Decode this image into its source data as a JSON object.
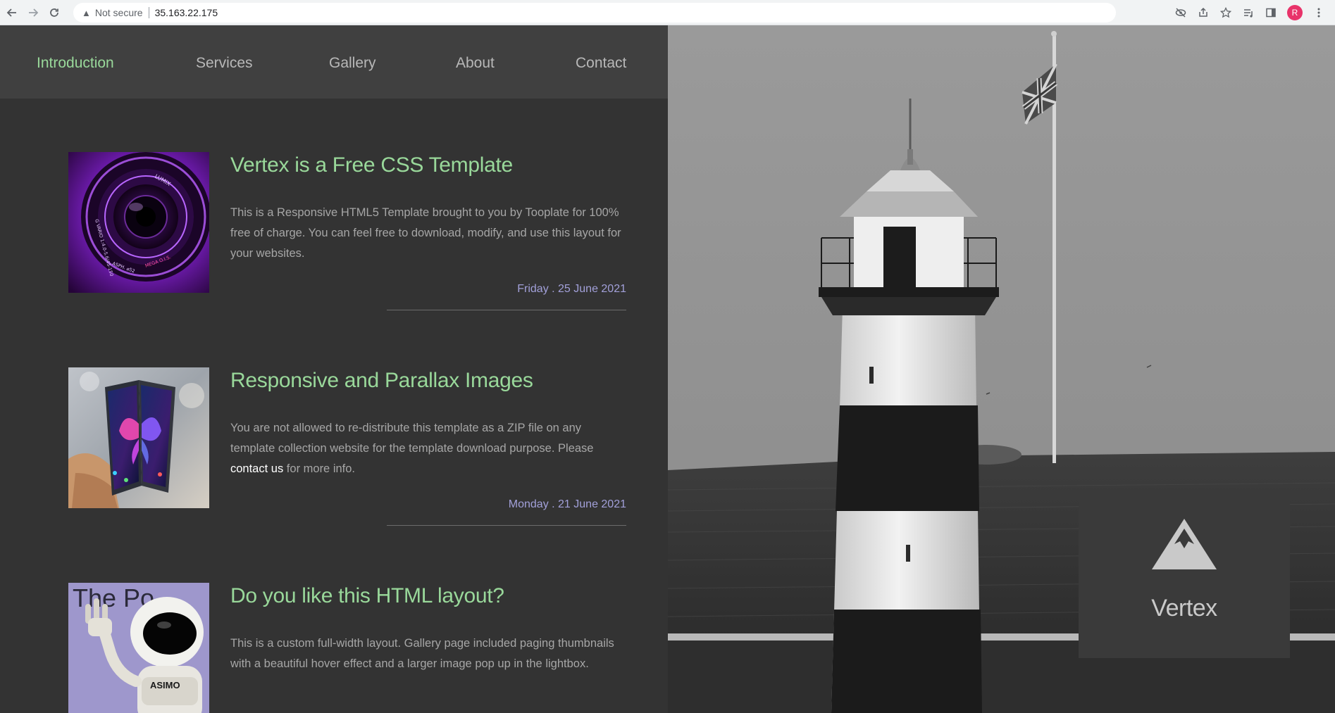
{
  "browser": {
    "security_label": "Not secure",
    "url": "35.163.22.175",
    "avatar_letter": "R"
  },
  "nav": {
    "items": [
      {
        "label": "Introduction",
        "active": true
      },
      {
        "label": "Services",
        "active": false
      },
      {
        "label": "Gallery",
        "active": false
      },
      {
        "label": "About",
        "active": false
      },
      {
        "label": "Contact",
        "active": false
      }
    ]
  },
  "posts": [
    {
      "title": "Vertex is a Free CSS Template",
      "body": "This is a Responsive HTML5 Template brought to you by Tooplate for 100% free of charge. You can feel free to download, modify, and use this layout for your websites.",
      "date": "Friday . 25 June 2021",
      "thumb": "camera-lens-image"
    },
    {
      "title": "Responsive and Parallax Images",
      "body_before": "You are not allowed to re-distribute this template as a ZIP file on any template collection website for the template download purpose. Please ",
      "body_link": "contact us",
      "body_after": " for more info.",
      "date": "Monday . 21 June 2021",
      "thumb": "foldable-phone-image"
    },
    {
      "title": "Do you like this HTML layout?",
      "body": "This is a custom full-width layout. Gallery page included paging thumbnails with a beautiful hover effect and a larger image pop up in the lightbox.",
      "thumb": "robot-image",
      "thumb_text_top": "The Po",
      "thumb_text_robot": "ASIMO"
    }
  ],
  "brand": {
    "name": "Vertex",
    "icon": "mountain-icon"
  },
  "colors": {
    "accent": "#99d89a",
    "date": "#a2a0d9",
    "panel": "#333333",
    "nav_bg": "#404040"
  }
}
